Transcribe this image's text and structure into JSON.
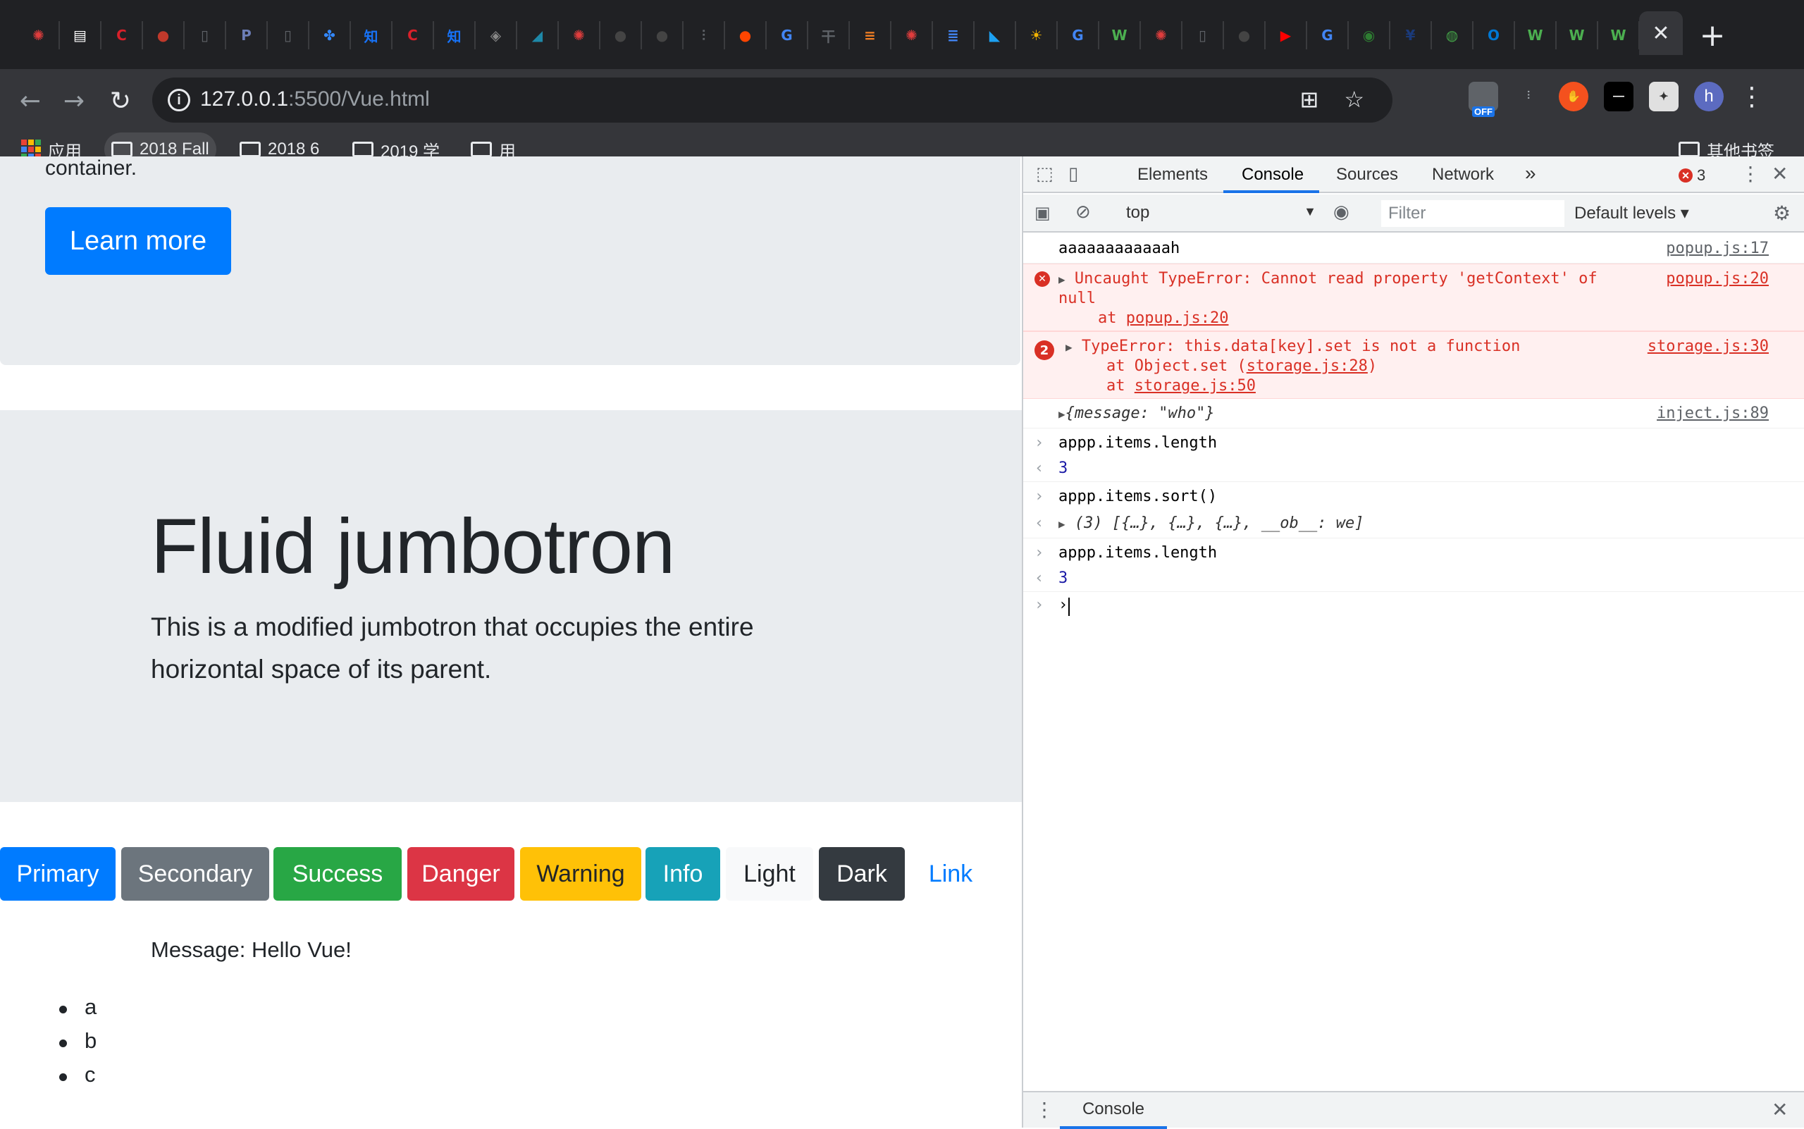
{
  "browser": {
    "tab_favicons": [
      {
        "icon": "canvas-icon",
        "color": "#e03d3d",
        "glyph": "✺"
      },
      {
        "icon": "newspaper-icon",
        "color": "#ffffff",
        "glyph": "▤"
      },
      {
        "icon": "c-logo-icon",
        "color": "#d8202a",
        "glyph": "C"
      },
      {
        "icon": "ninja-icon",
        "color": "#c0392b",
        "glyph": "●"
      },
      {
        "icon": "file-icon",
        "color": "#5f6368",
        "glyph": "▯"
      },
      {
        "icon": "php-icon",
        "color": "#6c7eb7",
        "glyph": "P"
      },
      {
        "icon": "file-icon",
        "color": "#5f6368",
        "glyph": "▯"
      },
      {
        "icon": "baidu-icon",
        "color": "#3388ff",
        "glyph": "✤"
      },
      {
        "icon": "zhihu-icon",
        "color": "#1772f6",
        "glyph": "知"
      },
      {
        "icon": "c-logo-icon",
        "color": "#d8202a",
        "glyph": "C"
      },
      {
        "icon": "zhihu-icon",
        "color": "#1772f6",
        "glyph": "知"
      },
      {
        "icon": "diamond-icon",
        "color": "#888888",
        "glyph": "◈"
      },
      {
        "icon": "wing-icon",
        "color": "#1e88a8",
        "glyph": "◢"
      },
      {
        "icon": "canvas-icon",
        "color": "#e03d3d",
        "glyph": "✺"
      },
      {
        "icon": "github-icon",
        "color": "#444444",
        "glyph": "●"
      },
      {
        "icon": "github-icon",
        "color": "#444444",
        "glyph": "●"
      },
      {
        "icon": "bars-icon",
        "color": "#5f6368",
        "glyph": "⫶"
      },
      {
        "icon": "reddit-icon",
        "color": "#ff4500",
        "glyph": "●"
      },
      {
        "icon": "google-icon",
        "color": "#4285f4",
        "glyph": "G"
      },
      {
        "icon": "gan-icon",
        "color": "#5f6368",
        "glyph": "干"
      },
      {
        "icon": "stack-icon",
        "color": "#f48024",
        "glyph": "≡"
      },
      {
        "icon": "canvas-icon",
        "color": "#e03d3d",
        "glyph": "✺"
      },
      {
        "icon": "docs-icon",
        "color": "#4285f4",
        "glyph": "≣"
      },
      {
        "icon": "bird-icon",
        "color": "#1da1f2",
        "glyph": "◣"
      },
      {
        "icon": "sun-icon",
        "color": "#f4b400",
        "glyph": "☀"
      },
      {
        "icon": "google-icon",
        "color": "#4285f4",
        "glyph": "G"
      },
      {
        "icon": "w3-icon",
        "color": "#4caf50",
        "glyph": "W"
      },
      {
        "icon": "canvas-icon",
        "color": "#e03d3d",
        "glyph": "✺"
      },
      {
        "icon": "file-icon",
        "color": "#5f6368",
        "glyph": "▯"
      },
      {
        "icon": "github-icon",
        "color": "#444444",
        "glyph": "●"
      },
      {
        "icon": "youtube-icon",
        "color": "#ff0000",
        "glyph": "▶"
      },
      {
        "icon": "google-icon",
        "color": "#4285f4",
        "glyph": "G"
      },
      {
        "icon": "badge-icon",
        "color": "#2e7d32",
        "glyph": "◉"
      },
      {
        "icon": "yankees-icon",
        "color": "#1a3a7a",
        "glyph": "¥"
      },
      {
        "icon": "globe-icon",
        "color": "#43a047",
        "glyph": "◍"
      },
      {
        "icon": "outlook-icon",
        "color": "#0078d4",
        "glyph": "O"
      },
      {
        "icon": "w3-icon",
        "color": "#4caf50",
        "glyph": "W"
      },
      {
        "icon": "w3-icon",
        "color": "#4caf50",
        "glyph": "W"
      },
      {
        "icon": "w3-icon",
        "color": "#4caf50",
        "glyph": "W"
      }
    ],
    "active_tab_close": "✕",
    "new_tab": "+",
    "url_host": "127.0.0.1",
    "url_rest": ":5500/Vue.html",
    "profile_initial": "h",
    "ext_off_label": "OFF",
    "bookmarks": {
      "apps": "应用",
      "items": [
        "2018 Fall",
        "2018 6",
        "2019 学",
        "用"
      ],
      "other": "其他书签"
    }
  },
  "page": {
    "container_text": "container.",
    "learn_more": "Learn more",
    "fluid_title": "Fluid jumbotron",
    "fluid_lead": "This is a modified jumbotron that occupies the entire horizontal space of its parent.",
    "buttons": [
      {
        "label": "Primary",
        "bg": "#007bff",
        "fg": "#ffffff"
      },
      {
        "label": "Secondary",
        "bg": "#6c757d",
        "fg": "#ffffff"
      },
      {
        "label": "Success",
        "bg": "#28a745",
        "fg": "#ffffff"
      },
      {
        "label": "Danger",
        "bg": "#dc3545",
        "fg": "#ffffff"
      },
      {
        "label": "Warning",
        "bg": "#ffc107",
        "fg": "#212529"
      },
      {
        "label": "Info",
        "bg": "#17a2b8",
        "fg": "#ffffff"
      },
      {
        "label": "Light",
        "bg": "#f8f9fa",
        "fg": "#212529"
      },
      {
        "label": "Dark",
        "bg": "#343a40",
        "fg": "#ffffff"
      },
      {
        "label": "Link",
        "bg": "transparent",
        "fg": "#007bff"
      }
    ],
    "message": "Message: Hello Vue!",
    "list_items": [
      "a",
      "b",
      "c"
    ]
  },
  "devtools": {
    "tabs": [
      "Elements",
      "Console",
      "Sources",
      "Network"
    ],
    "more_tabs": "»",
    "error_count": "3",
    "context": "top",
    "filter_placeholder": "Filter",
    "levels": "Default levels",
    "drawer_tab": "Console",
    "console": {
      "log1": {
        "text": "aaaaaaaaaaaah",
        "src": "popup.js:17"
      },
      "err1": {
        "line1": "Uncaught TypeError: Cannot read property 'getContext' of",
        "line2": "null",
        "at": "at ",
        "at_link": "popup.js:20",
        "src": "popup.js:20"
      },
      "err2": {
        "count": "2",
        "line1": "TypeError: this.data[key].set is not a function",
        "at1_pre": "at Object.set (",
        "at1_link": "storage.js:28",
        "at1_post": ")",
        "at2_pre": "at ",
        "at2_link": "storage.js:50",
        "src": "storage.js:30"
      },
      "obj": {
        "pre": "{message: ",
        "val": "\"who\"",
        "post": "}",
        "src": "inject.js:89"
      },
      "cmd1": "appp.items.length",
      "res1": "3",
      "cmd2": "appp.items.sort()",
      "res2": "(3) [{…}, {…}, {…}, __ob__: we]",
      "cmd3": "appp.items.length",
      "res3": "3",
      "input": "›"
    }
  }
}
